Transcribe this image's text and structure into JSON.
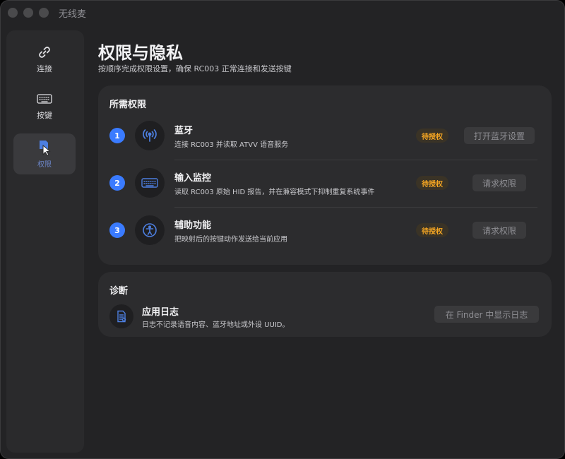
{
  "window": {
    "title": "无线麦"
  },
  "sidebar": {
    "items": [
      {
        "label": "连接",
        "icon": "link-icon"
      },
      {
        "label": "按键",
        "icon": "keyboard-icon"
      },
      {
        "label": "权限",
        "icon": "permission-icon",
        "active": true
      }
    ]
  },
  "header": {
    "title": "权限与隐私",
    "subtitle": "按顺序完成权限设置，确保 RC003 正常连接和发送按键"
  },
  "permissions": {
    "title": "所需权限",
    "items": [
      {
        "number": "1",
        "name": "蓝牙",
        "desc": "连接 RC003 并读取 ATVV 语音服务",
        "status": "待授权",
        "action": "打开蓝牙设置",
        "icon": "bluetooth-antenna-icon"
      },
      {
        "number": "2",
        "name": "输入监控",
        "desc": "读取 RC003 原始 HID 报告，并在兼容模式下抑制重复系统事件",
        "status": "待授权",
        "action": "请求权限",
        "icon": "keyboard-icon"
      },
      {
        "number": "3",
        "name": "辅助功能",
        "desc": "把映射后的按键动作发送给当前应用",
        "status": "待授权",
        "action": "请求权限",
        "icon": "accessibility-icon"
      }
    ]
  },
  "diagnostics": {
    "title": "诊断",
    "log_name": "应用日志",
    "log_desc": "日志不记录语音内容、蓝牙地址或外设 UUID。",
    "action": "在 Finder 中显示日志"
  },
  "colors": {
    "accent": "#3a7bff",
    "pending": "#f5a623",
    "icon_blue": "#4d7fe0"
  }
}
